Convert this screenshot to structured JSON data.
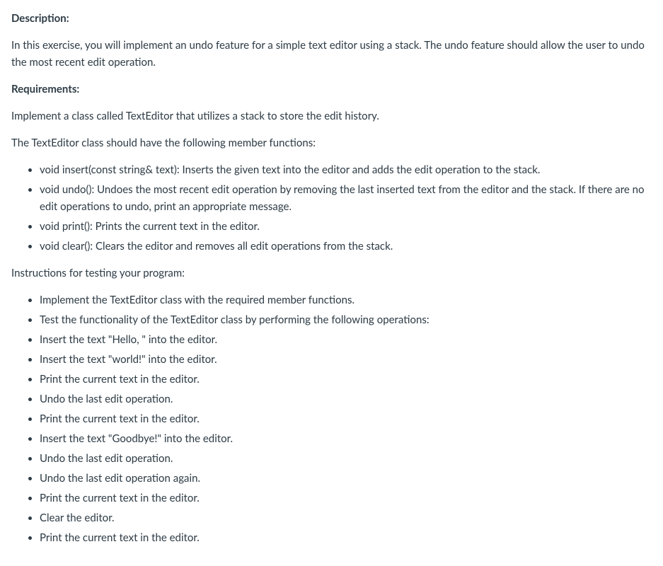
{
  "sections": {
    "description_label": "Description:",
    "description_text": "In this exercise, you will implement an undo feature for a simple text editor using a stack. The undo feature should allow the user to undo the most recent edit operation.",
    "requirements_label": "Requirements:",
    "requirements_intro": "Implement a class called TextEditor that utilizes a stack to store the edit history.",
    "requirements_subintro": "The TextEditor class should have the following member functions:",
    "member_functions": [
      "void insert(const string& text): Inserts the given text into the editor and adds the edit operation to the stack.",
      "void undo(): Undoes the most recent edit operation by removing the last inserted text from the editor and the stack. If there are no edit operations to undo, print an appropriate message.",
      "void print(): Prints the current text in the editor.",
      "void clear(): Clears the editor and removes all edit operations from the stack."
    ],
    "instructions_label": "Instructions for testing your program:",
    "instructions": [
      "Implement the TextEditor class with the required member functions.",
      "Test the functionality of the TextEditor class by performing the following operations:",
      "Insert the text \"Hello, \" into the editor.",
      "Insert the text \"world!\" into the editor.",
      "Print the current text in the editor.",
      "Undo the last edit operation.",
      "Print the current text in the editor.",
      "Insert the text \"Goodbye!\" into the editor.",
      "Undo the last edit operation.",
      "Undo the last edit operation again.",
      "Print the current text in the editor.",
      "Clear the editor.",
      "Print the current text in the editor."
    ]
  }
}
